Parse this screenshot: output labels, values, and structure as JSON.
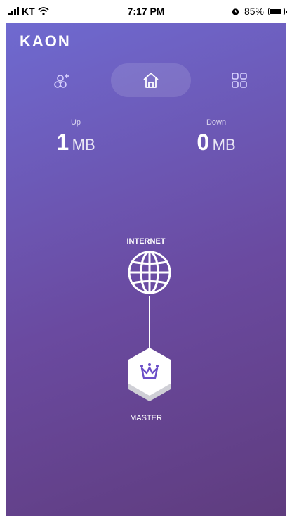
{
  "status_bar": {
    "carrier": "KT",
    "time": "7:17 PM",
    "battery": "85%",
    "icons": [
      "signal-icon",
      "wifi-icon",
      "alarm-icon",
      "battery-icon"
    ]
  },
  "brand": {
    "logo": "KAON"
  },
  "tabs": [
    {
      "name": "add-device",
      "icon": "add-device-icon"
    },
    {
      "name": "home",
      "icon": "home-icon",
      "active": true
    },
    {
      "name": "apps",
      "icon": "grid-icon"
    }
  ],
  "traffic": {
    "up": {
      "label": "Up",
      "value": "1",
      "unit": "MB"
    },
    "down": {
      "label": "Down",
      "value": "0",
      "unit": "MB"
    }
  },
  "topology": {
    "internet_label": "INTERNET",
    "internet_icon": "globe-icon",
    "master_label": "MASTER",
    "master_icon": "crown-icon"
  },
  "colors": {
    "gradient_top": "#6f6ad0",
    "gradient_bottom": "#5f3c7e",
    "accent": "#6b4fc8"
  }
}
